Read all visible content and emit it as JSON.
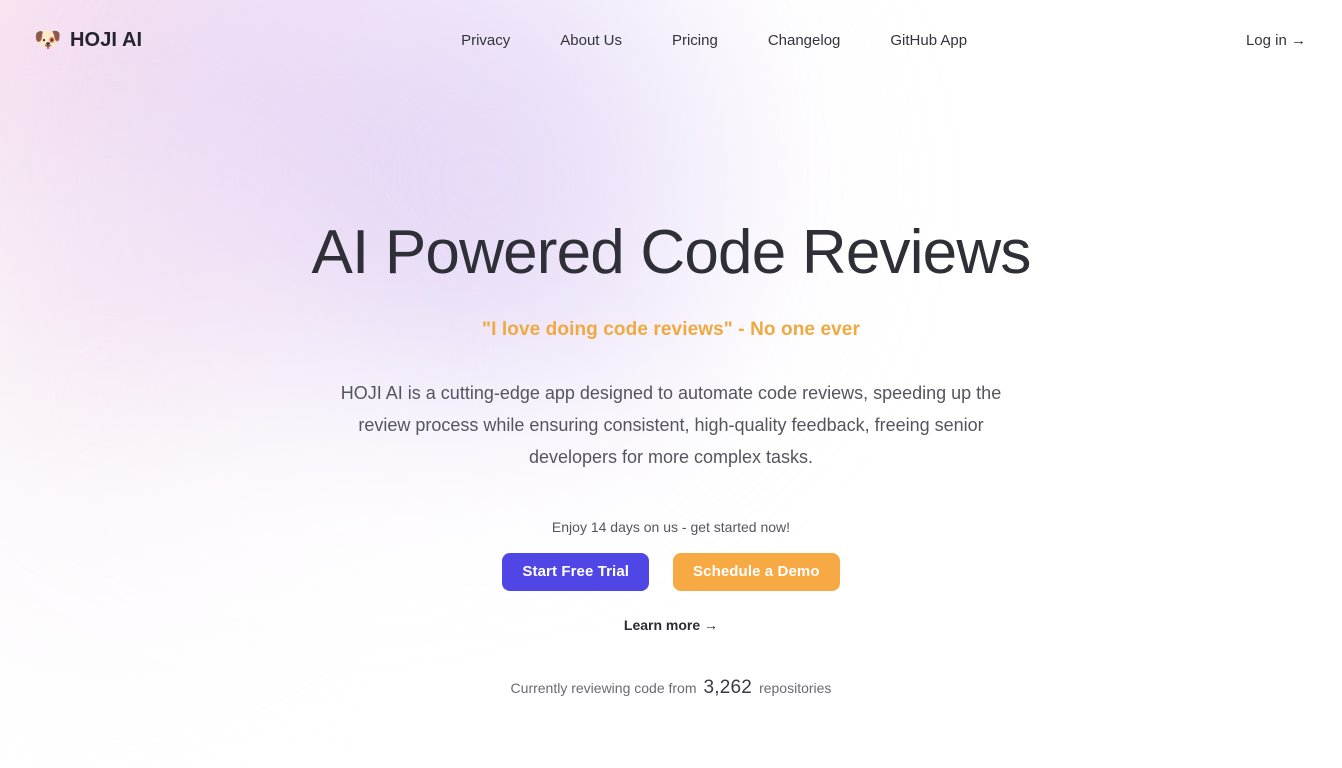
{
  "brand": {
    "mark": "🐶",
    "mark_icon_name": "dog-face-logo-icon",
    "name": "HOJI AI"
  },
  "nav": {
    "items": [
      {
        "label": "Privacy"
      },
      {
        "label": "About Us"
      },
      {
        "label": "Pricing"
      },
      {
        "label": "Changelog"
      },
      {
        "label": "GitHub App"
      }
    ],
    "login_label": "Log in →"
  },
  "hero": {
    "title": "AI Powered Code Reviews",
    "tagline": "\"I love doing code reviews\" - No one ever",
    "description": "HOJI AI is a cutting-edge app designed to automate code reviews, speeding up the review process while ensuring consistent, high-quality feedback, freeing senior developers for more complex tasks.",
    "trial_note": "Enjoy 14 days on us - get started now!",
    "primary_cta": "Start Free Trial",
    "secondary_cta": "Schedule a Demo",
    "learn_more": "Learn more →"
  },
  "counter": {
    "prefix": "Currently reviewing code from",
    "value": "3,262",
    "suffix": "repositories"
  },
  "colors": {
    "primary": "#4f46e5",
    "secondary": "#f7a944",
    "tagline": "#f0a93f",
    "heading": "#2f2f38",
    "body_text": "#55555f",
    "page_background": "#ffffff",
    "gradient_pink": "#f8d8e8",
    "gradient_lilac": "#e4cff3"
  }
}
